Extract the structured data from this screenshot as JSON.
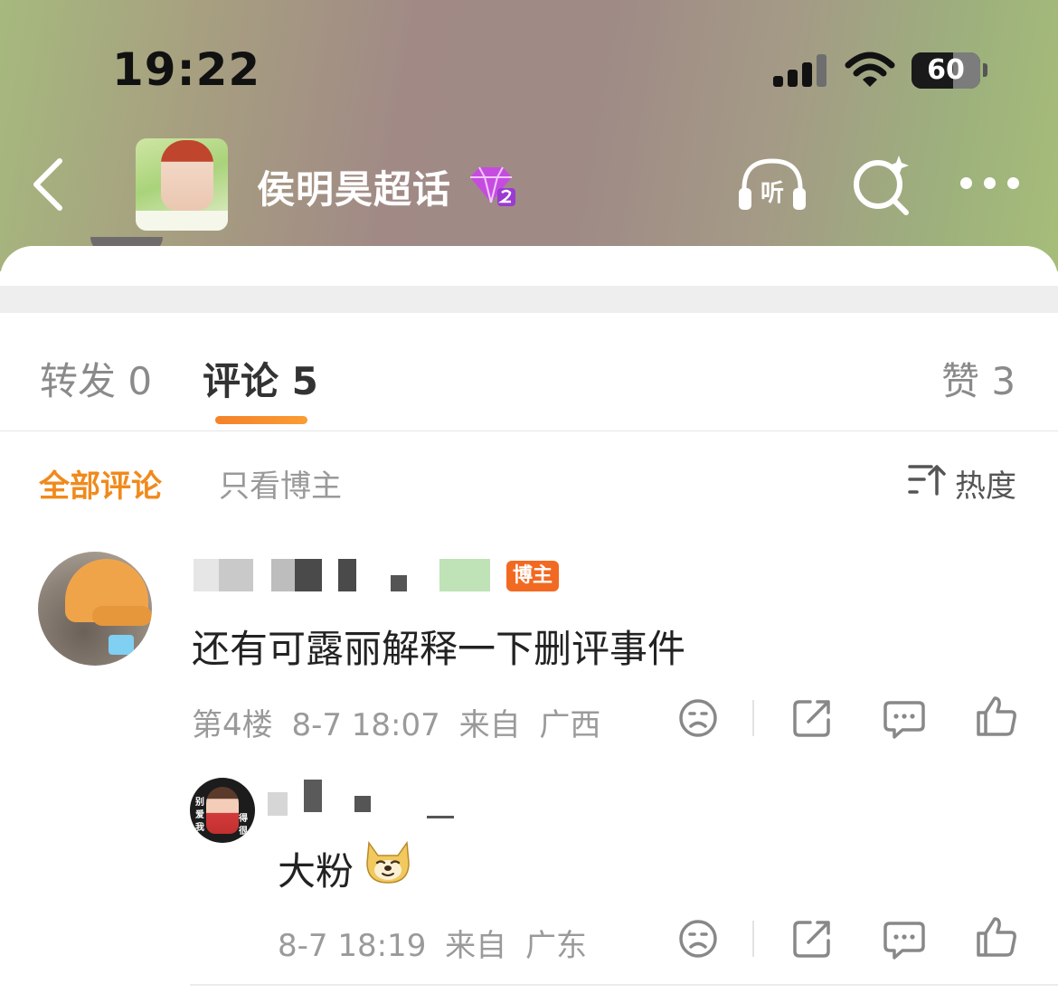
{
  "status_bar": {
    "time": "19:22",
    "battery": "60",
    "battery_level": 0.6
  },
  "header": {
    "topic_title": "侯明昊超话"
  },
  "tabs": [
    {
      "label": "转发 0"
    },
    {
      "label": "评论 5"
    },
    {
      "label": "赞 3"
    }
  ],
  "filters": {
    "all": "全部评论",
    "owner_only": "只看博主",
    "sort": "热度"
  },
  "comments": [
    {
      "host_badge": "博主",
      "text": "还有可露丽解释一下删评事件",
      "floor": "第4楼",
      "time": "8-7 18:07",
      "from_label": "来自",
      "location": "广西"
    }
  ],
  "reply": {
    "avatar_text_left": [
      "别",
      "爱",
      "我"
    ],
    "avatar_text_right": [
      "得",
      "很"
    ],
    "text": "大粉",
    "time": "8-7 18:19",
    "from_label": "来自",
    "location": "广东"
  },
  "colors": {
    "accent_orange": "#f08a1c",
    "host_badge": "#f26a22",
    "text_primary": "#222222",
    "text_muted": "#9a9a9a"
  },
  "icons": [
    "back-icon",
    "gem-level-icon",
    "listen-icon",
    "search-icon",
    "more-icon",
    "sort-icon",
    "dislike-icon",
    "share-icon",
    "comment-icon",
    "like-icon",
    "doge-emoji-icon"
  ]
}
